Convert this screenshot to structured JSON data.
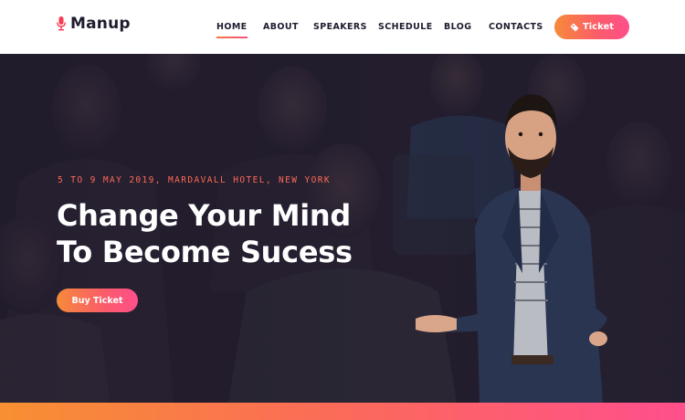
{
  "brand": {
    "name": "Manup",
    "icon": "microphone-icon",
    "accent": "#f63b53"
  },
  "nav": {
    "items": [
      {
        "label": "HOME",
        "active": true
      },
      {
        "label": "ABOUT",
        "active": false
      },
      {
        "label": "SPEAKERS",
        "active": false
      },
      {
        "label": "SCHEDULE",
        "active": false
      },
      {
        "label": "BLOG",
        "active": false
      },
      {
        "label": "CONTACTS",
        "active": false
      }
    ],
    "ticket_label": "Ticket",
    "ticket_icon": "ticket-icon"
  },
  "hero": {
    "date_location": "5 TO 9 MAY 2019, MARDAVALL HOTEL, NEW YORK",
    "title_line1": "Change Your Mind",
    "title_line2": "To Become Sucess",
    "cta_label": "Buy Ticket"
  },
  "colors": {
    "gradient_start": "#f68a3a",
    "gradient_end": "#ff4f8b",
    "hero_overlay": "#1f1a2f",
    "date_color": "#ff6a57"
  }
}
